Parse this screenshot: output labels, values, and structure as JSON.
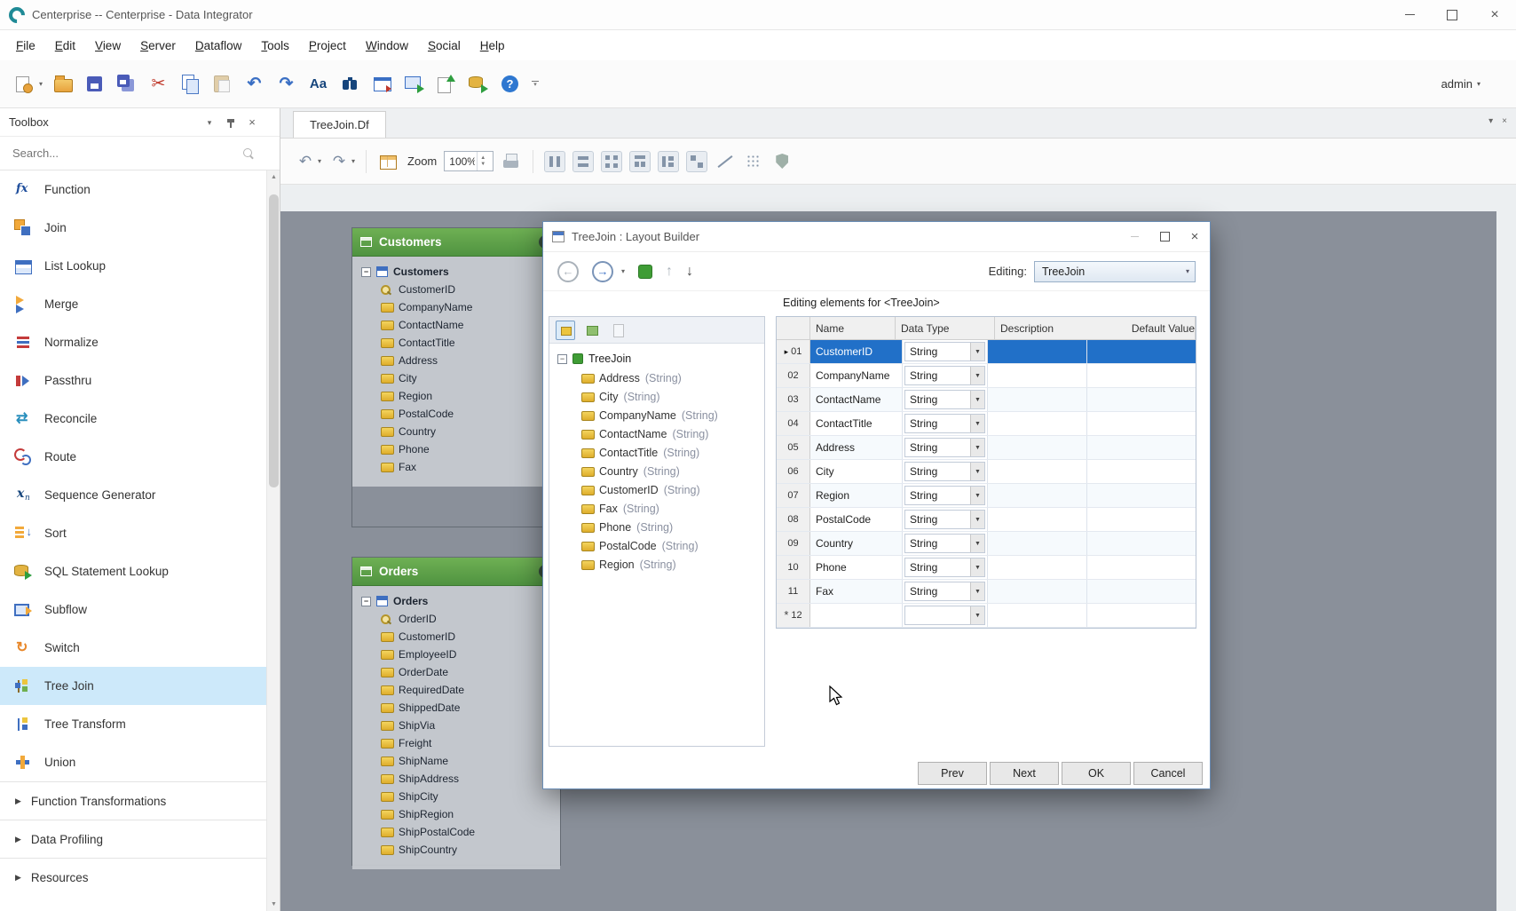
{
  "window": {
    "title": "Centerprise -- Centerprise - Data Integrator"
  },
  "menu": {
    "items": [
      "File",
      "Edit",
      "View",
      "Server",
      "Dataflow",
      "Tools",
      "Project",
      "Window",
      "Social",
      "Help"
    ]
  },
  "toolbar": {
    "icons": [
      "new-dataflow",
      "open",
      "save",
      "save-all",
      "cut",
      "copy",
      "paste",
      "undo",
      "redo",
      "font-case",
      "find",
      "preview",
      "start",
      "export",
      "deploy",
      "help",
      "toolbar-overflow"
    ],
    "font_case_label": "Aa",
    "user_label": "admin"
  },
  "toolbox": {
    "title": "Toolbox",
    "search_placeholder": "Search...",
    "items": [
      {
        "label": "Function",
        "icon": "function"
      },
      {
        "label": "Join",
        "icon": "join"
      },
      {
        "label": "List Lookup",
        "icon": "list-lookup"
      },
      {
        "label": "Merge",
        "icon": "merge"
      },
      {
        "label": "Normalize",
        "icon": "normalize"
      },
      {
        "label": "Passthru",
        "icon": "passthru"
      },
      {
        "label": "Reconcile",
        "icon": "reconcile"
      },
      {
        "label": "Route",
        "icon": "route"
      },
      {
        "label": "Sequence Generator",
        "icon": "sequence-generator"
      },
      {
        "label": "Sort",
        "icon": "sort"
      },
      {
        "label": "SQL Statement Lookup",
        "icon": "sql-statement-lookup"
      },
      {
        "label": "Subflow",
        "icon": "subflow"
      },
      {
        "label": "Switch",
        "icon": "switch"
      },
      {
        "label": "Tree Join",
        "icon": "tree-join",
        "selected": true
      },
      {
        "label": "Tree Transform",
        "icon": "tree-transform"
      },
      {
        "label": "Union",
        "icon": "union"
      }
    ],
    "sections": [
      {
        "label": "Function Transformations"
      },
      {
        "label": "Data Profiling"
      },
      {
        "label": "Resources"
      }
    ]
  },
  "document": {
    "tab_label": "TreeJoin.Df",
    "zoom_label": "Zoom",
    "zoom_value": "100%",
    "toolbar_icons": [
      "undo",
      "redo",
      "edit-layout",
      "print",
      "auto-layout-columns",
      "auto-layout-rows",
      "auto-layout-grid",
      "auto-layout-tree",
      "auto-layout-org",
      "auto-layout-compact",
      "link-style",
      "snap-grid",
      "protect"
    ]
  },
  "canvas": {
    "boxes": [
      {
        "title": "Customers",
        "root": "Customers",
        "fields": [
          {
            "name": "CustomerID",
            "key": true
          },
          {
            "name": "CompanyName"
          },
          {
            "name": "ContactName"
          },
          {
            "name": "ContactTitle"
          },
          {
            "name": "Address"
          },
          {
            "name": "City"
          },
          {
            "name": "Region"
          },
          {
            "name": "PostalCode"
          },
          {
            "name": "Country"
          },
          {
            "name": "Phone"
          },
          {
            "name": "Fax"
          }
        ]
      },
      {
        "title": "Orders",
        "root": "Orders",
        "fields": [
          {
            "name": "OrderID",
            "key": true
          },
          {
            "name": "CustomerID"
          },
          {
            "name": "EmployeeID"
          },
          {
            "name": "OrderDate"
          },
          {
            "name": "RequiredDate"
          },
          {
            "name": "ShippedDate"
          },
          {
            "name": "ShipVia"
          },
          {
            "name": "Freight"
          },
          {
            "name": "ShipName"
          },
          {
            "name": "ShipAddress"
          },
          {
            "name": "ShipCity"
          },
          {
            "name": "ShipRegion"
          },
          {
            "name": "ShipPostalCode"
          },
          {
            "name": "ShipCountry"
          }
        ]
      }
    ]
  },
  "dialog": {
    "title": "TreeJoin : Layout Builder",
    "editing_label": "Editing:",
    "editing_value": "TreeJoin",
    "tree": {
      "root": "TreeJoin",
      "nodes": [
        {
          "name": "Address",
          "type": "(String)"
        },
        {
          "name": "City",
          "type": "(String)"
        },
        {
          "name": "CompanyName",
          "type": "(String)"
        },
        {
          "name": "ContactName",
          "type": "(String)"
        },
        {
          "name": "ContactTitle",
          "type": "(String)"
        },
        {
          "name": "Country",
          "type": "(String)"
        },
        {
          "name": "CustomerID",
          "type": "(String)"
        },
        {
          "name": "Fax",
          "type": "(String)"
        },
        {
          "name": "Phone",
          "type": "(String)"
        },
        {
          "name": "PostalCode",
          "type": "(String)"
        },
        {
          "name": "Region",
          "type": "(String)"
        }
      ]
    },
    "grid": {
      "caption": "Editing elements for <TreeJoin>",
      "columns": [
        "Name",
        "Data Type",
        "Description",
        "Default Value"
      ],
      "rows": [
        {
          "num": "01",
          "name": "CustomerID",
          "type": "String",
          "selected": true,
          "current": true
        },
        {
          "num": "02",
          "name": "CompanyName",
          "type": "String"
        },
        {
          "num": "03",
          "name": "ContactName",
          "type": "String"
        },
        {
          "num": "04",
          "name": "ContactTitle",
          "type": "String"
        },
        {
          "num": "05",
          "name": "Address",
          "type": "String"
        },
        {
          "num": "06",
          "name": "City",
          "type": "String"
        },
        {
          "num": "07",
          "name": "Region",
          "type": "String"
        },
        {
          "num": "08",
          "name": "PostalCode",
          "type": "String"
        },
        {
          "num": "09",
          "name": "Country",
          "type": "String"
        },
        {
          "num": "10",
          "name": "Phone",
          "type": "String"
        },
        {
          "num": "11",
          "name": "Fax",
          "type": "String"
        },
        {
          "num": "12",
          "name": "",
          "type": "",
          "new_row": true
        }
      ]
    },
    "buttons": [
      "Prev",
      "Next",
      "OK",
      "Cancel"
    ]
  }
}
